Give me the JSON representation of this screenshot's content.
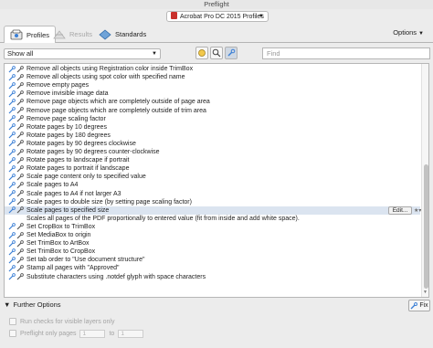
{
  "window": {
    "title": "Preflight"
  },
  "profile_selector": {
    "value": "Acrobat Pro DC 2015 Profiles"
  },
  "tabs": [
    {
      "label": "Profiles",
      "icon": "preflight-profiles-icon",
      "state": "active"
    },
    {
      "label": "Results",
      "icon": "results-icon",
      "state": "disabled"
    },
    {
      "label": "Standards",
      "icon": "standards-icon",
      "state": "normal"
    }
  ],
  "options": {
    "label": "Options"
  },
  "filter": {
    "value": "Show all"
  },
  "find": {
    "placeholder": "Find"
  },
  "fixups": [
    {
      "label": "Remove all objects using Registration color inside TrimBox"
    },
    {
      "label": "Remove all objects using spot color with specified name"
    },
    {
      "label": "Remove empty pages"
    },
    {
      "label": "Remove invisible image data"
    },
    {
      "label": "Remove page objects which are completely outside of page area"
    },
    {
      "label": "Remove page objects which are completely outside of trim area"
    },
    {
      "label": "Remove page scaling factor"
    },
    {
      "label": "Rotate pages by 10 degrees"
    },
    {
      "label": "Rotate pages by 180 degrees"
    },
    {
      "label": "Rotate pages by 90 degrees clockwise"
    },
    {
      "label": "Rotate pages by 90 degrees counter-clockwise"
    },
    {
      "label": "Rotate pages to landscape if portrait"
    },
    {
      "label": "Rotate pages to portrait if landscape"
    },
    {
      "label": "Scale page content only to specified value"
    },
    {
      "label": "Scale pages to A4"
    },
    {
      "label": "Scale pages to A4 if not larger A3"
    },
    {
      "label": "Scale pages to double size (by setting page scaling factor)"
    },
    {
      "label": "Scale pages to specified size",
      "selected": true
    },
    {
      "label": "Scales all pages of the PDF proportionally to entered value (fit from inside and add white space).",
      "description": true
    },
    {
      "label": "Set CropBox to TrimBox"
    },
    {
      "label": "Set MediaBox to origin"
    },
    {
      "label": "Set TrimBox to ArtBox"
    },
    {
      "label": "Set TrimBox to CropBox"
    },
    {
      "label": "Set tab order to \"Use document structure\""
    },
    {
      "label": "Stamp all pages with \"Approved\""
    },
    {
      "label": "Substitute characters using .notdef glyph with space characters"
    }
  ],
  "row_actions": {
    "edit_label": "Edit..."
  },
  "further_options": {
    "label": "Further Options",
    "run_checks_visible_layers": "Run checks for visible layers only",
    "preflight_only_pages": "Preflight only pages",
    "page_from": "1",
    "to_label": "to",
    "page_to": "1"
  },
  "fix_button": {
    "label": "Fix"
  },
  "colors": {
    "selected_row": "#dbe4f0",
    "accent": "#3b7fd6",
    "pdf_red": "#c9302c"
  }
}
